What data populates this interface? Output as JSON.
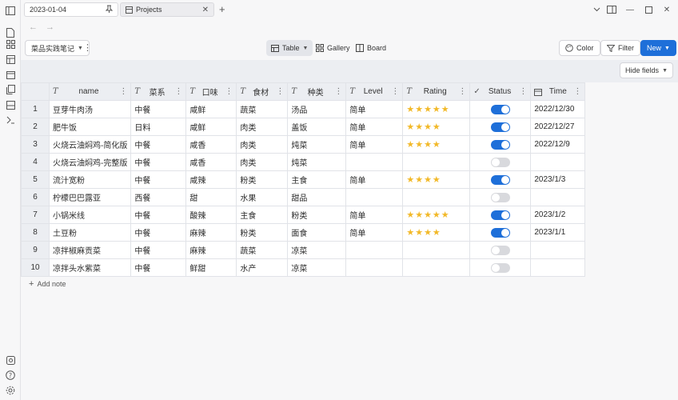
{
  "tabs": [
    {
      "label": "2023-01-04"
    },
    {
      "label": "Projects"
    }
  ],
  "toolbar": {
    "notebook": "菜品实践笔记",
    "views": [
      {
        "label": "Table",
        "active": true
      },
      {
        "label": "Gallery",
        "active": false
      },
      {
        "label": "Board",
        "active": false
      }
    ],
    "color_label": "Color",
    "filter_label": "Filter",
    "new_label": "New"
  },
  "hide_fields_label": "Hide fields",
  "columns": [
    {
      "label": "name",
      "type": "text"
    },
    {
      "label": "菜系",
      "type": "text"
    },
    {
      "label": "口味",
      "type": "text"
    },
    {
      "label": "食材",
      "type": "text"
    },
    {
      "label": "种类",
      "type": "text"
    },
    {
      "label": "Level",
      "type": "text"
    },
    {
      "label": "Rating",
      "type": "text"
    },
    {
      "label": "Status",
      "type": "check"
    },
    {
      "label": "Time",
      "type": "date"
    }
  ],
  "rows": [
    {
      "num": "1",
      "name": "豆芽牛肉汤",
      "cuisine": "中餐",
      "flavor": "咸鲜",
      "ingredient": "蔬菜",
      "kind": "汤品",
      "level": "简单",
      "rating": 5,
      "status": true,
      "time": "2022/12/30"
    },
    {
      "num": "2",
      "name": "肥牛饭",
      "cuisine": "日料",
      "flavor": "咸鲜",
      "ingredient": "肉类",
      "kind": "盖饭",
      "level": "简单",
      "rating": 4,
      "status": true,
      "time": "2022/12/27"
    },
    {
      "num": "3",
      "name": "火烧云油焖鸡-简化版",
      "cuisine": "中餐",
      "flavor": "咸香",
      "ingredient": "肉类",
      "kind": "炖菜",
      "level": "简单",
      "rating": 4,
      "status": true,
      "time": "2022/12/9"
    },
    {
      "num": "4",
      "name": "火烧云油焖鸡-完整版",
      "cuisine": "中餐",
      "flavor": "咸香",
      "ingredient": "肉类",
      "kind": "炖菜",
      "level": "",
      "rating": 0,
      "status": false,
      "time": ""
    },
    {
      "num": "5",
      "name": "流汁宽粉",
      "cuisine": "中餐",
      "flavor": "咸辣",
      "ingredient": "粉类",
      "kind": "主食",
      "level": "简单",
      "rating": 4,
      "status": true,
      "time": "2023/1/3"
    },
    {
      "num": "6",
      "name": "柠檬巴巴露亚",
      "cuisine": "西餐",
      "flavor": "甜",
      "ingredient": "水果",
      "kind": "甜品",
      "level": "",
      "rating": 0,
      "status": false,
      "time": ""
    },
    {
      "num": "7",
      "name": "小锅米线",
      "cuisine": "中餐",
      "flavor": "酸辣",
      "ingredient": "主食",
      "kind": "粉类",
      "level": "简单",
      "rating": 5,
      "status": true,
      "time": "2023/1/2"
    },
    {
      "num": "8",
      "name": "土豆粉",
      "cuisine": "中餐",
      "flavor": "麻辣",
      "ingredient": "粉类",
      "kind": "面食",
      "level": "简单",
      "rating": 4,
      "status": true,
      "time": "2023/1/1"
    },
    {
      "num": "9",
      "name": "凉拌椒麻贡菜",
      "cuisine": "中餐",
      "flavor": "麻辣",
      "ingredient": "蔬菜",
      "kind": "凉菜",
      "level": "",
      "rating": 0,
      "status": false,
      "time": ""
    },
    {
      "num": "10",
      "name": "凉拌头水紫菜",
      "cuisine": "中餐",
      "flavor": "鲜甜",
      "ingredient": "水产",
      "kind": "凉菜",
      "level": "",
      "rating": 0,
      "status": false,
      "time": ""
    }
  ],
  "add_note_label": "Add note",
  "colors": {
    "accent": "#1e6fd9",
    "star": "#f2b928",
    "toggle_off": "#d8d9dd"
  }
}
